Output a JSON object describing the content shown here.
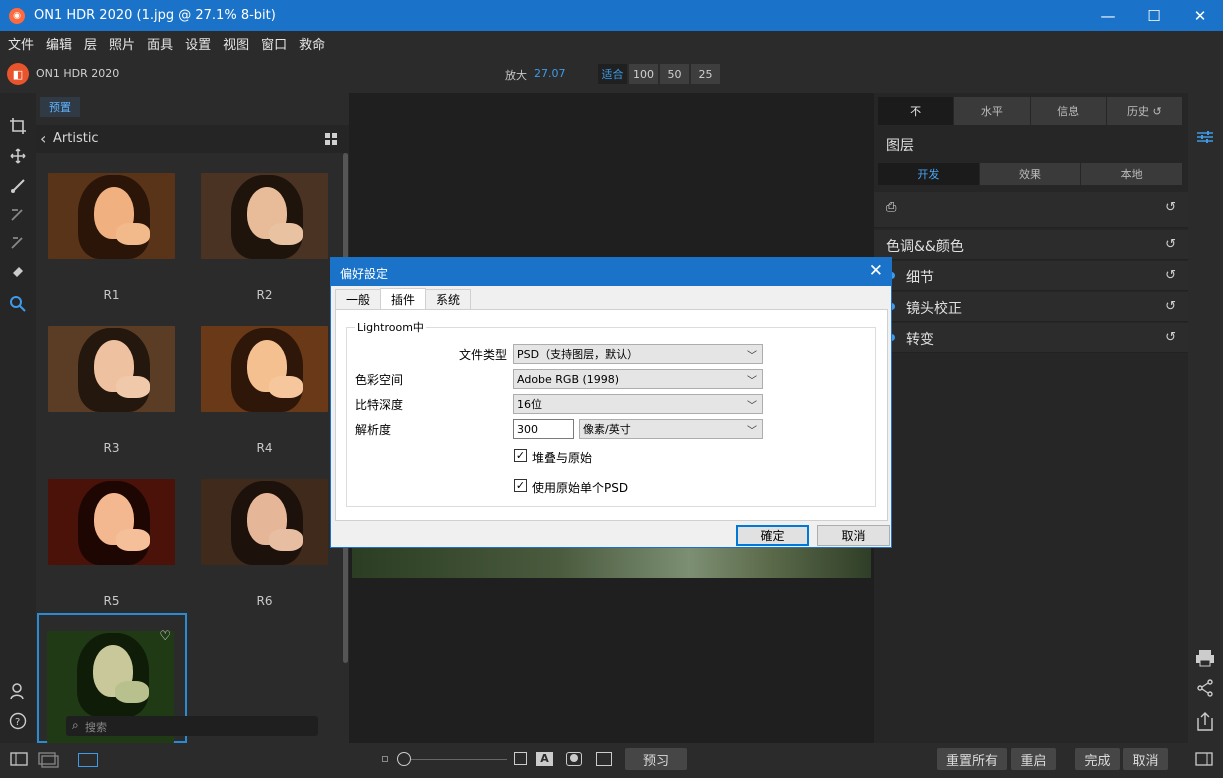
{
  "window": {
    "title": "ON1 HDR 2020 (1.jpg @ 27.1% 8-bit)",
    "minimize": "—",
    "maximize": "☐",
    "close": "✕"
  },
  "menu": [
    "文件",
    "编辑",
    "层",
    "照片",
    "面具",
    "设置",
    "视图",
    "窗口",
    "救命"
  ],
  "app": {
    "name": "ON1 HDR 2020"
  },
  "zoom": {
    "label": "放大",
    "value": "27.07",
    "fit": "适合",
    "levels": [
      "100",
      "50",
      "25"
    ]
  },
  "browser": {
    "tab": "预置",
    "crumb": "Artistic",
    "presets": [
      "R1",
      "R2",
      "R3",
      "R4",
      "R5",
      "R6"
    ],
    "search_placeholder": "搜索"
  },
  "right": {
    "tabs": [
      "不",
      "水平",
      "信息",
      "历史"
    ],
    "layer_title": "图层",
    "sub_tabs": [
      "开发",
      "效果",
      "本地"
    ],
    "sections": [
      "色调&&颜色",
      "细节",
      "镜头校正",
      "转变"
    ]
  },
  "bottom": {
    "preview": "预习",
    "reset_all": "重置所有",
    "restart": "重启",
    "done": "完成",
    "cancel": "取消"
  },
  "dialog": {
    "title": "偏好設定",
    "tabs": [
      "一般",
      "插件",
      "系统"
    ],
    "group": "Lightroom中",
    "file_type_label": "文件类型",
    "file_type_value": "PSD（支持图层，默认）",
    "color_space_label": "色彩空间",
    "color_space_value": "Adobe RGB (1998)",
    "bit_depth_label": "比特深度",
    "bit_depth_value": "16位",
    "resolution_label": "解析度",
    "resolution_value": "300",
    "resolution_unit": "像素/英寸",
    "stack_label": "堆叠与原始",
    "single_psd_label": "使用原始单个PSD",
    "ok": "確定",
    "cancel": "取消"
  },
  "colors": {
    "accent": "#1a73c9",
    "highlight": "#3d9be9",
    "background": "#1e1e1e"
  }
}
